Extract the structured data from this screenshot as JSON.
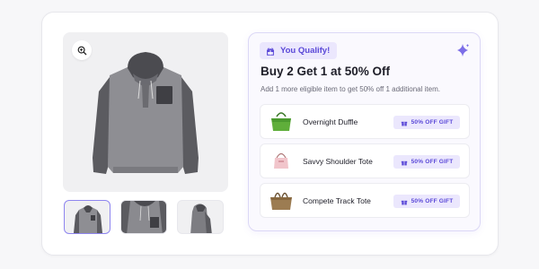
{
  "promo": {
    "qualify_label": "You Qualify!",
    "title": "Buy 2 Get 1 at 50% Off",
    "subtitle": "Add 1 more eligible item to get 50% off 1 additional item.",
    "items": [
      {
        "name": "Overnight Duffle",
        "badge": "50% OFF GIFT",
        "icon": "green-bag-icon"
      },
      {
        "name": "Savvy Shoulder Tote",
        "badge": "50% OFF GIFT",
        "icon": "pink-bag-icon"
      },
      {
        "name": "Compete Track Tote",
        "badge": "50% OFF GIFT",
        "icon": "brown-tote-icon"
      }
    ]
  },
  "gallery": {
    "main_image": "grey-hoodie-image",
    "zoom_icon": "zoom-in-icon",
    "thumbnails": [
      "hoodie-front-thumb",
      "hoodie-pocket-closeup-thumb",
      "hoodie-side-thumb"
    ],
    "active_thumbnail": 0
  },
  "colors": {
    "accent": "#5a48d8",
    "badge_bg": "#ebe7fd",
    "panel_border": "#dcd8f6"
  }
}
